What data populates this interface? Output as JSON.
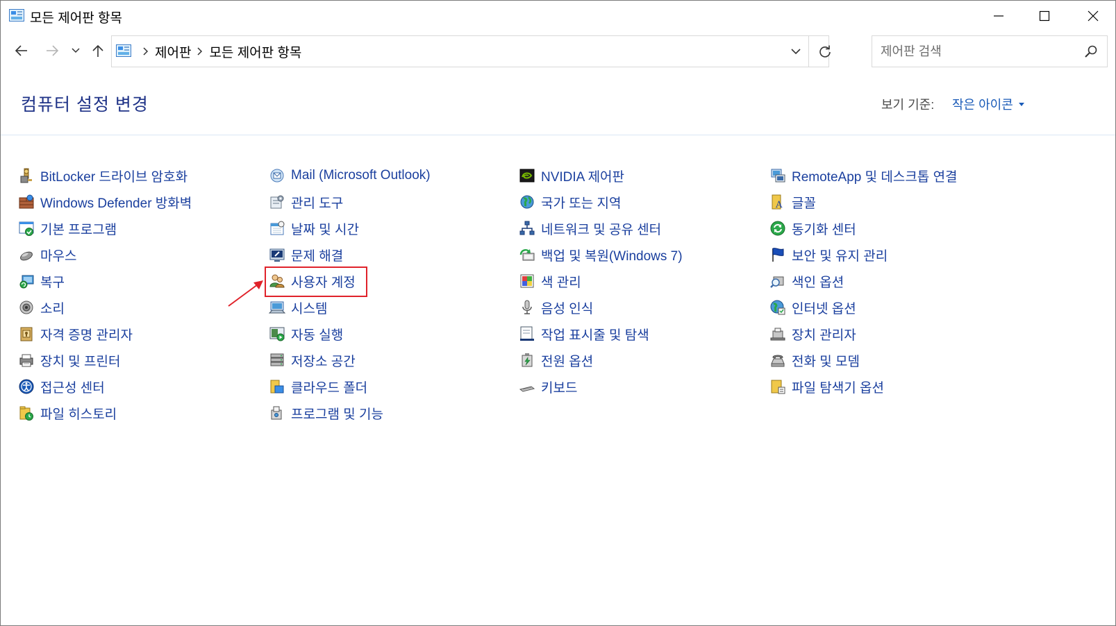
{
  "window": {
    "title": "모든 제어판 항목"
  },
  "navigation": {
    "breadcrumbs": [
      "제어판",
      "모든 제어판 항목"
    ]
  },
  "search": {
    "placeholder": "제어판 검색"
  },
  "header": {
    "title": "컴퓨터 설정 변경",
    "view_by_label": "보기 기준:",
    "view_by_value": "작은 아이콘"
  },
  "items": {
    "col0": [
      {
        "label": "BitLocker 드라이브 암호화",
        "icon": "bitlocker-icon"
      },
      {
        "label": "Windows Defender 방화벽",
        "icon": "firewall-icon"
      },
      {
        "label": "기본 프로그램",
        "icon": "default-programs-icon"
      },
      {
        "label": "마우스",
        "icon": "mouse-icon"
      },
      {
        "label": "복구",
        "icon": "recovery-icon"
      },
      {
        "label": "소리",
        "icon": "sound-icon"
      },
      {
        "label": "자격 증명 관리자",
        "icon": "credential-manager-icon"
      },
      {
        "label": "장치 및 프린터",
        "icon": "devices-printers-icon"
      },
      {
        "label": "접근성 센터",
        "icon": "ease-of-access-icon"
      },
      {
        "label": "파일 히스토리",
        "icon": "file-history-icon"
      }
    ],
    "col1": [
      {
        "label": "Mail (Microsoft Outlook)",
        "icon": "mail-icon"
      },
      {
        "label": "관리 도구",
        "icon": "admin-tools-icon"
      },
      {
        "label": "날짜 및 시간",
        "icon": "date-time-icon"
      },
      {
        "label": "문제 해결",
        "icon": "troubleshooting-icon"
      },
      {
        "label": "사용자 계정",
        "icon": "user-accounts-icon"
      },
      {
        "label": "시스템",
        "icon": "system-icon"
      },
      {
        "label": "자동 실행",
        "icon": "autoplay-icon"
      },
      {
        "label": "저장소 공간",
        "icon": "storage-spaces-icon"
      },
      {
        "label": "클라우드 폴더",
        "icon": "cloud-folder-icon"
      },
      {
        "label": "프로그램 및 기능",
        "icon": "programs-features-icon"
      }
    ],
    "col2": [
      {
        "label": "NVIDIA 제어판",
        "icon": "nvidia-icon"
      },
      {
        "label": "국가 또는 지역",
        "icon": "region-icon"
      },
      {
        "label": "네트워크 및 공유 센터",
        "icon": "network-icon"
      },
      {
        "label": "백업 및 복원(Windows 7)",
        "icon": "backup-restore-icon"
      },
      {
        "label": "색 관리",
        "icon": "color-management-icon"
      },
      {
        "label": "음성 인식",
        "icon": "speech-recognition-icon"
      },
      {
        "label": "작업 표시줄 및 탐색",
        "icon": "taskbar-icon"
      },
      {
        "label": "전원 옵션",
        "icon": "power-options-icon"
      },
      {
        "label": "키보드",
        "icon": "keyboard-icon"
      }
    ],
    "col3": [
      {
        "label": "RemoteApp 및 데스크톱 연결",
        "icon": "remoteapp-icon"
      },
      {
        "label": "글꼴",
        "icon": "fonts-icon"
      },
      {
        "label": "동기화 센터",
        "icon": "sync-center-icon"
      },
      {
        "label": "보안 및 유지 관리",
        "icon": "security-maintenance-icon"
      },
      {
        "label": "색인 옵션",
        "icon": "indexing-options-icon"
      },
      {
        "label": "인터넷 옵션",
        "icon": "internet-options-icon"
      },
      {
        "label": "장치 관리자",
        "icon": "device-manager-icon"
      },
      {
        "label": "전화 및 모뎀",
        "icon": "phone-modem-icon"
      },
      {
        "label": "파일 탐색기 옵션",
        "icon": "file-explorer-options-icon"
      }
    ]
  },
  "colors": {
    "link": "#1a3f9e",
    "title": "#1e3287",
    "highlight": "#e0222a"
  }
}
